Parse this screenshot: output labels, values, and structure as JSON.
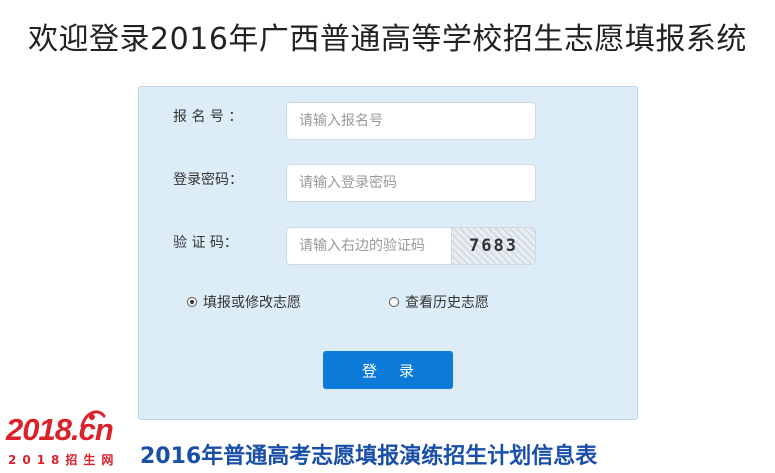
{
  "page_title": "欢迎登录2016年广西普通高等学校招生志愿填报系统",
  "form": {
    "registration_label": "报 名 号 ：",
    "registration_placeholder": "请输入报名号",
    "password_label": "登录密码：",
    "password_placeholder": "请输入登录密码",
    "captcha_label": "验 证 码：",
    "captcha_placeholder": "请输入右边的验证码",
    "captcha_code": "7683",
    "radio_options": [
      {
        "label": "填报或修改志愿",
        "checked": true
      },
      {
        "label": "查看历史志愿",
        "checked": false
      }
    ],
    "login_button": "登录"
  },
  "logo": {
    "main_text": "2018.cn",
    "sub_text": "2018招生网"
  },
  "plan_link": "2016年普通高考志愿填报演练招生计划信息表",
  "colors": {
    "panel_bg": "#dcedf8",
    "button_bg": "#0b7ad9",
    "logo_red": "#d9232a",
    "link_blue": "#1a4fa8"
  }
}
